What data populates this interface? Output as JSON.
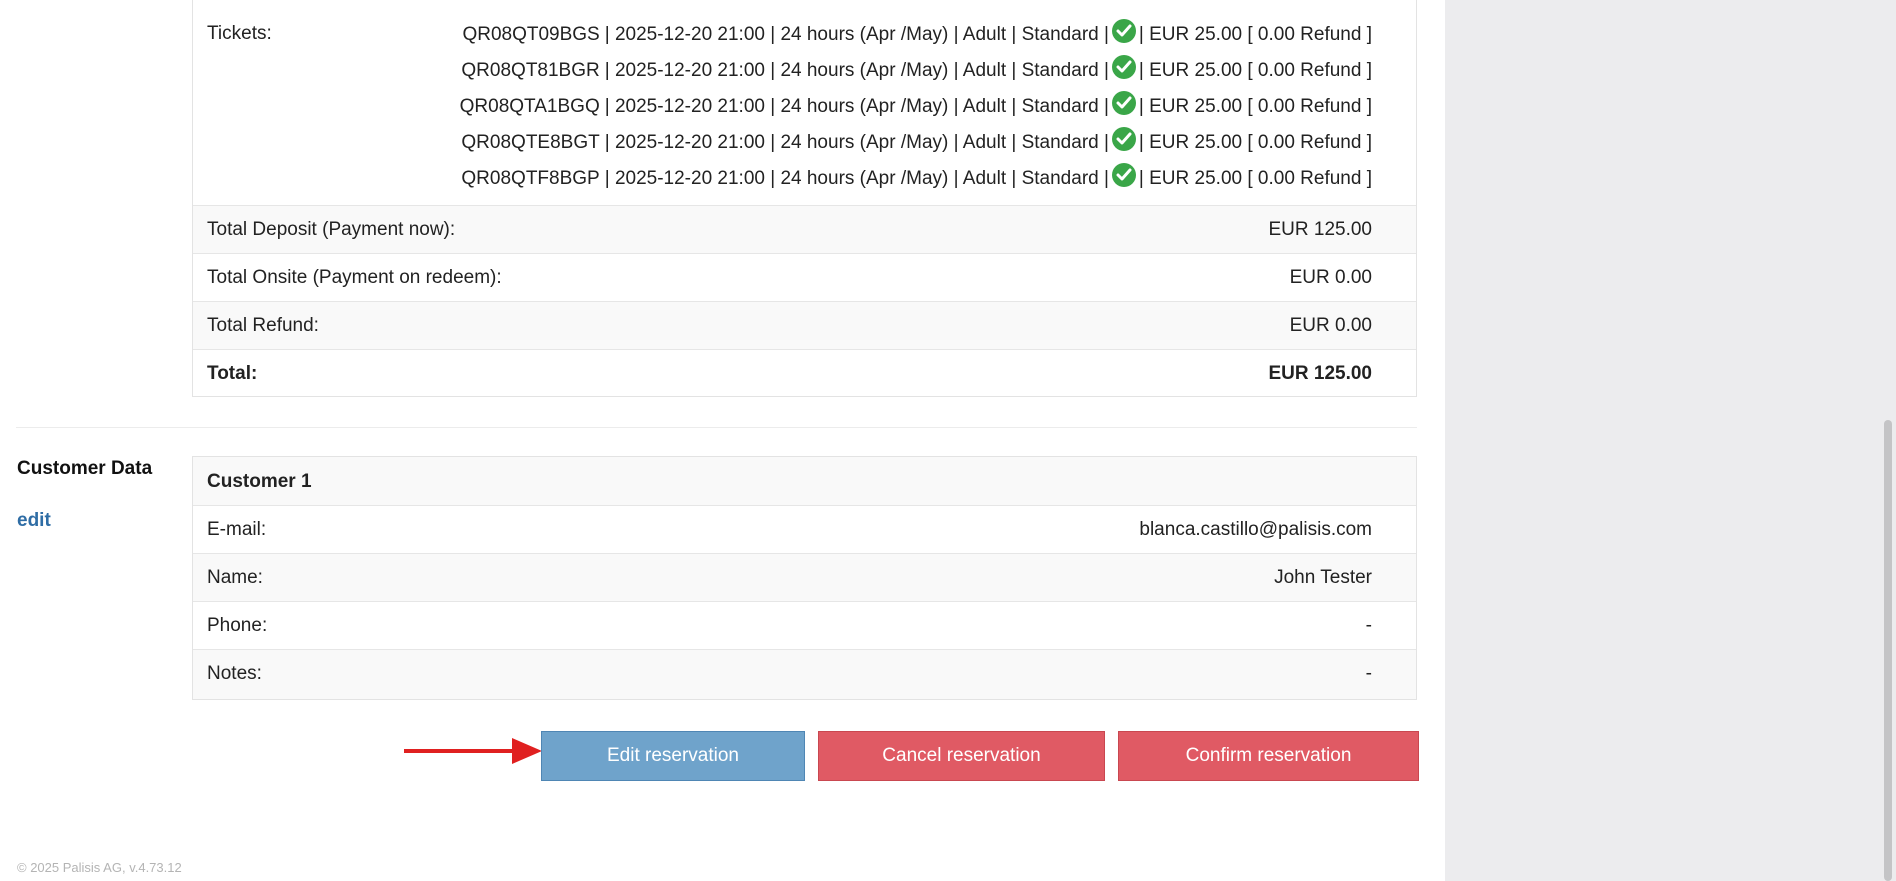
{
  "tickets": {
    "label": "Tickets:",
    "lines": [
      {
        "code": "QR08QT09BGS",
        "details": "| 2025-12-20 21:00 | 24 hours (Apr /May) | Adult | Standard |",
        "price": "| EUR 25.00 [ 0.00 Refund ]"
      },
      {
        "code": "QR08QT81BGR",
        "details": "| 2025-12-20 21:00 | 24 hours (Apr /May) | Adult | Standard |",
        "price": "| EUR 25.00 [ 0.00 Refund ]"
      },
      {
        "code": "QR08QTA1BGQ",
        "details": "| 2025-12-20 21:00 | 24 hours (Apr /May) | Adult | Standard |",
        "price": "| EUR 25.00 [ 0.00 Refund ]"
      },
      {
        "code": "QR08QTE8BGT",
        "details": "| 2025-12-20 21:00 | 24 hours (Apr /May) | Adult | Standard |",
        "price": "| EUR 25.00 [ 0.00 Refund ]"
      },
      {
        "code": "QR08QTF8BGP",
        "details": "| 2025-12-20 21:00 | 24 hours (Apr /May) | Adult | Standard |",
        "price": "| EUR 25.00 [ 0.00 Refund ]"
      }
    ],
    "status_icon": "check-circle-icon"
  },
  "totals": {
    "deposit_label": "Total Deposit (Payment now):",
    "deposit_value": "EUR 125.00",
    "onsite_label": "Total Onsite (Payment on redeem):",
    "onsite_value": "EUR 0.00",
    "refund_label": "Total Refund:",
    "refund_value": "EUR 0.00",
    "total_label": "Total:",
    "total_value": "EUR 125.00"
  },
  "customer_section": {
    "title": "Customer Data",
    "edit_link": "edit",
    "card_title": "Customer 1",
    "email_label": "E-mail:",
    "email_value": "blanca.castillo@palisis.com",
    "name_label": "Name:",
    "name_value": "John Tester",
    "phone_label": "Phone:",
    "phone_value": "-",
    "notes_label": "Notes:",
    "notes_value": "-"
  },
  "actions": {
    "edit": "Edit reservation",
    "cancel": "Cancel reservation",
    "confirm": "Confirm reservation"
  },
  "annotation": {
    "arrow_color": "#e02020"
  },
  "colors": {
    "edit_button": "#6fa3cb",
    "danger_button": "#e05a64",
    "link": "#2f6da5",
    "check": "#3aa648"
  },
  "footer": "© 2025 Palisis AG, v.4.73.12"
}
